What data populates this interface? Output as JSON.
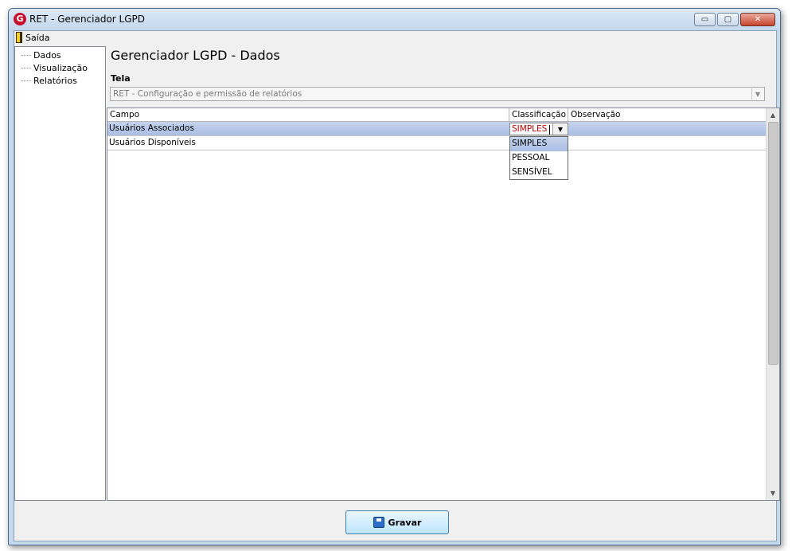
{
  "window": {
    "title": "RET - Gerenciador LGPD",
    "app_icon": "G",
    "controls": {
      "minimize": "▭",
      "maximize": "▢",
      "close": "✕"
    }
  },
  "menu": {
    "exit_label": "Saída"
  },
  "tree": {
    "items": [
      {
        "label": "Dados"
      },
      {
        "label": "Visualização"
      },
      {
        "label": "Relatórios"
      }
    ]
  },
  "page": {
    "title": "Gerenciador LGPD - Dados"
  },
  "screen_selector": {
    "label": "Tela",
    "value": "RET - Configuração e permissão de relatórios"
  },
  "grid": {
    "columns": [
      "Campo",
      "Classificação",
      "Observação"
    ],
    "rows": [
      {
        "campo": "Usuários Associados",
        "classificacao": "SIMPLES",
        "observacao": "",
        "selected": true
      },
      {
        "campo": "Usuários Disponíveis",
        "classificacao": "",
        "observacao": "",
        "selected": false
      }
    ],
    "editor": {
      "value": "SIMPLES",
      "options": [
        "SIMPLES",
        "PESSOAL",
        "SENSÍVEL"
      ],
      "highlighted": "SIMPLES"
    }
  },
  "actions": {
    "save_label": "Gravar"
  },
  "colors": {
    "selection": "#b8c9ea",
    "editor_text": "#c00000",
    "app_icon": "#c8102e"
  }
}
